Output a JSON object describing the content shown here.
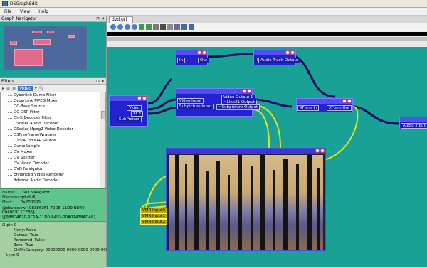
{
  "app": {
    "title": "DSGraphEdit"
  },
  "menu": {
    "file": "File",
    "view": "View",
    "help": "Help"
  },
  "navigator": {
    "title": "Graph Navigator",
    "pin_icon": "pin-icon",
    "close_icon": "close-icon"
  },
  "filters": {
    "title": "Filters",
    "toolbar_selected": "Video",
    "items": [
      "Cyberlink Dump Filter",
      "CyberLink MPEG Muxer",
      "DC-Base Source",
      "DC-DSP Filter",
      "DivX Decoder Filter",
      "DScaler Audio Decoder",
      "DScaler Mpeg2 Video Decoder",
      "DSFreeFrameWrapper",
      "DTS/AC3/DD+ Source",
      "DumpSample",
      "DV Muxer",
      "DV Splitter",
      "DV Video Decoder",
      "DVD Navigator",
      "Enhanced Video Renderer",
      "ffdshow Audio Decoder"
    ]
  },
  "info": {
    "name_k": "Name:",
    "name_v": "DVD Navigator",
    "file_k": "Filename:",
    "file_v": "qdvd.dll",
    "merit_k": "Merit:",
    "merit_v": "0x200000",
    "guid1": "@device:sw:{083863F1-70DE-11D0-BD40-00A0C911CE86}",
    "guid2": "\\{9B8C4620-2C1A-11D0-8493-00A02438AD48}"
  },
  "pins": {
    "header": "pin 0",
    "rows": [
      "Many: False",
      "Output: True",
      "Rendered: False",
      "Zero: True",
      "ClsPinCategory: 00000000-0000-0000-0000-000000000000",
      "type 0"
    ]
  },
  "document": {
    "tab": "dvd.grf"
  },
  "graph": {
    "dvd_source": {
      "pins": [
        "Video",
        "AC3",
        "SubPicture"
      ]
    },
    "top_small": {
      "in": "In",
      "out": "Out"
    },
    "audio_track": {
      "in": "In",
      "label": "Audio Track 1",
      "out": "Output"
    },
    "decoder": {
      "in_video": "Video Input",
      "in_sub": "Subpicture Input",
      "out_video": "Video Output 1",
      "out_line21": "~Line21 Output",
      "out_sub": "~Subpicture Output"
    },
    "xform": {
      "in": "XForm In",
      "out": "XForm Out"
    },
    "audio_render": {
      "in": "Audio Input pin"
    },
    "vmr_inputs": [
      "VMR Input0",
      "VMR Input1",
      "VMR Input2"
    ]
  }
}
